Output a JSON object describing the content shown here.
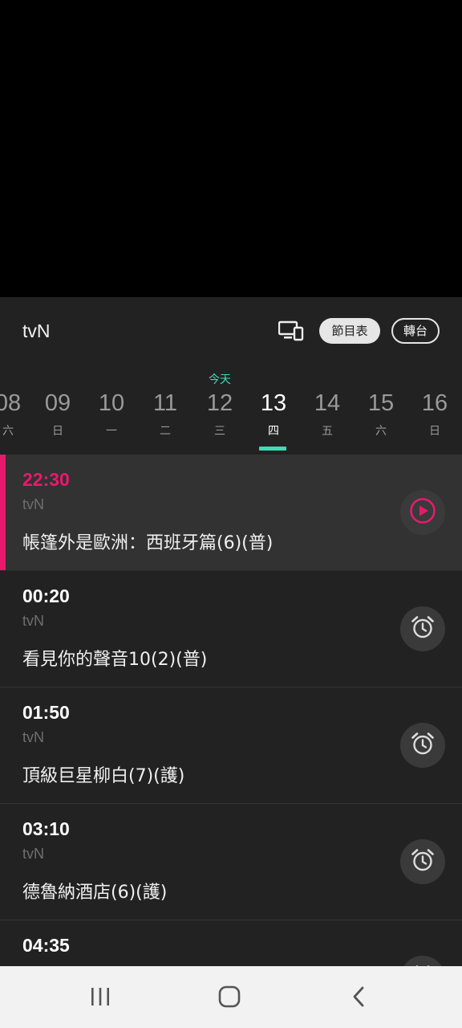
{
  "header": {
    "channel": "tvN",
    "schedule_label": "節目表",
    "switch_label": "轉台"
  },
  "days": {
    "today_label": "今天",
    "items": [
      {
        "num": "08",
        "wk": "六"
      },
      {
        "num": "09",
        "wk": "日"
      },
      {
        "num": "10",
        "wk": "一"
      },
      {
        "num": "11",
        "wk": "二"
      },
      {
        "num": "12",
        "wk": "三"
      },
      {
        "num": "13",
        "wk": "四"
      },
      {
        "num": "14",
        "wk": "五"
      },
      {
        "num": "15",
        "wk": "六"
      },
      {
        "num": "16",
        "wk": "日"
      }
    ],
    "selected": "13",
    "accent_color": "#3ddcb5"
  },
  "programs": [
    {
      "time": "22:30",
      "channel": "tvN",
      "title": "帳篷外是歐洲：西班牙篇(6)(普)",
      "action_icon": "play-icon",
      "current": true
    },
    {
      "time": "00:20",
      "channel": "tvN",
      "title": "看見你的聲音10(2)(普)",
      "action_icon": "alarm-icon"
    },
    {
      "time": "01:50",
      "channel": "tvN",
      "title": "頂級巨星柳白(7)(護)",
      "action_icon": "alarm-icon"
    },
    {
      "time": "03:10",
      "channel": "tvN",
      "title": "德魯納酒店(6)(護)",
      "action_icon": "alarm-icon"
    },
    {
      "time": "04:35",
      "channel": "",
      "title": "",
      "action_icon": "alarm-icon"
    }
  ],
  "colors": {
    "live_accent": "#e8196d",
    "panel_bg": "#222222"
  },
  "navbar": {
    "icons": [
      "recent-apps-icon",
      "home-icon",
      "back-icon"
    ]
  }
}
